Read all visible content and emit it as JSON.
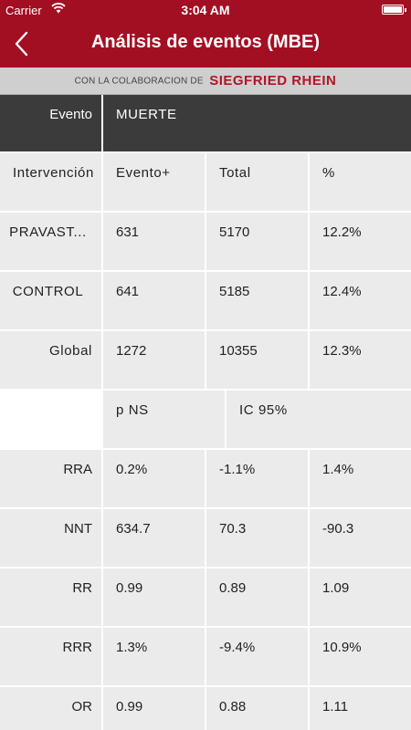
{
  "status_bar": {
    "carrier": "Carrier",
    "time": "3:04 AM"
  },
  "nav": {
    "title": "Análisis de eventos (MBE)"
  },
  "banner": {
    "prefix": "CON LA COLABORACION DE",
    "brand": "SIEGFRIED RHEIN"
  },
  "table": {
    "event_label": "Evento",
    "event_value": "MUERTE",
    "columns_header": {
      "label": "Intervención",
      "c1": "Evento+",
      "c2": "Total",
      "c3": "%"
    },
    "groups": [
      {
        "label": "PRAVAST...",
        "c1": "631",
        "c2": "5170",
        "c3": "12.2%"
      },
      {
        "label": "CONTROL",
        "c1": "641",
        "c2": "5185",
        "c3": "12.4%"
      },
      {
        "label": "Global",
        "c1": "1272",
        "c2": "10355",
        "c3": "12.3%"
      }
    ],
    "stats_header": {
      "c1": "p NS",
      "c2": "IC 95%"
    },
    "stats": [
      {
        "label": "RRA",
        "c1": "0.2%",
        "c2": "-1.1%",
        "c3": "1.4%"
      },
      {
        "label": "NNT",
        "c1": "634.7",
        "c2": "70.3",
        "c3": "-90.3"
      },
      {
        "label": "RR",
        "c1": "0.99",
        "c2": "0.89",
        "c3": "1.09"
      },
      {
        "label": "RRR",
        "c1": "1.3%",
        "c2": "-9.4%",
        "c3": "10.9%"
      },
      {
        "label": "OR",
        "c1": "0.99",
        "c2": "0.88",
        "c3": "1.11"
      }
    ]
  }
}
